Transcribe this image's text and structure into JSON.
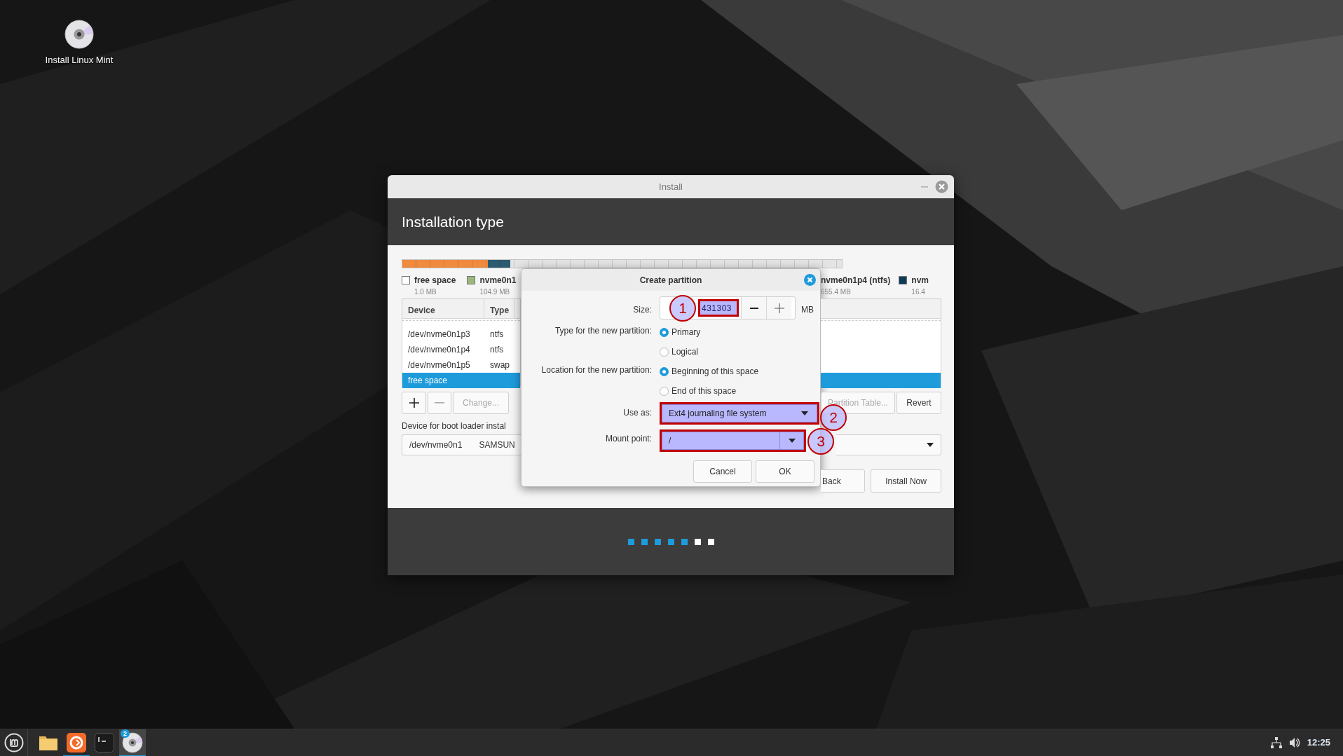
{
  "desktop_icons": [
    {
      "label": "Install Linux Mint"
    }
  ],
  "installer": {
    "title": "Install",
    "header": "Installation type",
    "legend_left": [
      {
        "label": "free space",
        "size": "1.0 MB",
        "color": "#ffffff"
      },
      {
        "label": "nvme0n1",
        "size": "104.9 MB",
        "color": "#9bb87c"
      }
    ],
    "legend_right": [
      {
        "label": "nvme0n1p4 (ntfs)",
        "size": "655.4 MB"
      },
      {
        "label": "nvm",
        "size": "16.4",
        "color": "#0d3b57"
      }
    ],
    "table": {
      "columns": [
        "Device",
        "Type"
      ],
      "rows": [
        {
          "device": "/dev/nvme0n1p3",
          "type": "ntfs",
          "selected": false
        },
        {
          "device": "/dev/nvme0n1p4",
          "type": "ntfs",
          "selected": false
        },
        {
          "device": "/dev/nvme0n1p5",
          "type": "swap",
          "selected": false
        },
        {
          "device": "free space",
          "type": "",
          "selected": true
        }
      ]
    },
    "partition_buttons": [
      {
        "kind": "add",
        "disabled": false
      },
      {
        "kind": "remove",
        "disabled": true
      },
      {
        "kind": "text",
        "label": "Change...",
        "disabled": true
      }
    ],
    "right_buttons": [
      {
        "label": "Partition Table...",
        "disabled": true
      },
      {
        "label": "Revert",
        "disabled": false
      }
    ],
    "boot_loader_label": "Device for boot loader instal",
    "boot_loader_device": {
      "device": "/dev/nvme0n1",
      "model": "SAMSUN"
    },
    "nav_buttons": [
      "Back",
      "Install Now"
    ],
    "progress_steps": [
      {
        "done": true
      },
      {
        "done": true
      },
      {
        "done": true
      },
      {
        "done": true
      },
      {
        "done": true
      },
      {
        "done": false
      },
      {
        "done": false
      }
    ]
  },
  "dialog": {
    "title": "Create partition",
    "size": {
      "label": "Size:",
      "value": "431303",
      "unit": "MB",
      "highlighted": true,
      "annotation": "1"
    },
    "partition_type": {
      "label": "Type for the new partition:",
      "options": [
        {
          "label": "Primary",
          "selected": true
        },
        {
          "label": "Logical",
          "selected": false
        }
      ]
    },
    "location": {
      "label": "Location for the new partition:",
      "options": [
        {
          "label": "Beginning of this space",
          "selected": true
        },
        {
          "label": "End of this space",
          "selected": false
        }
      ]
    },
    "use_as": {
      "label": "Use as:",
      "value": "Ext4 journaling file system",
      "highlighted": true,
      "annotation": "2"
    },
    "mount_point": {
      "label": "Mount point:",
      "value": "/",
      "highlighted": true,
      "annotation": "3"
    },
    "buttons": [
      "Cancel",
      "OK"
    ]
  },
  "taskbar": {
    "items": [
      {
        "kind": "files",
        "running": false,
        "active": false
      },
      {
        "kind": "browser",
        "running": true,
        "active": false
      },
      {
        "kind": "terminal",
        "running": false,
        "active": false
      },
      {
        "kind": "disc",
        "running": true,
        "active": true,
        "badge": "2"
      }
    ],
    "clock": "12:25"
  }
}
